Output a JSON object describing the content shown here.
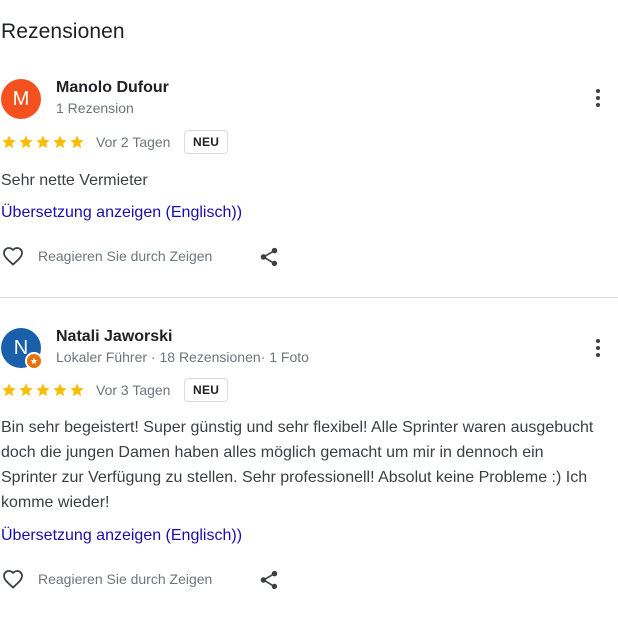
{
  "section": {
    "title": "Rezensionen"
  },
  "reviews": [
    {
      "avatar_letter": "M",
      "avatar_color": "#f4511e",
      "name": "Manolo Dufour",
      "meta": "1 Rezension",
      "rating": 5,
      "date": "Vor 2 Tagen",
      "badge": "NEU",
      "text": "Sehr nette Vermieter",
      "translate_label": "Übersetzung anzeigen (Englisch))",
      "react_label": "Reagieren Sie durch Zeigen"
    },
    {
      "avatar_letter": "N",
      "avatar_color": "#1a5faa",
      "local_guide": true,
      "name": "Natali Jaworski",
      "meta": "Lokaler Führer · 18  Rezensionen· 1 Foto",
      "rating": 5,
      "date": "Vor 3 Tagen",
      "badge": "NEU",
      "text": "Bin sehr begeistert! Super günstig und sehr flexibel! Alle Sprinter waren ausgebucht doch die jungen Damen haben alles möglich gemacht um mir in dennoch ein Sprinter zur Verfügung zu stellen. Sehr professionell! Absolut keine Probleme :) Ich komme wieder!",
      "translate_label": "Übersetzung anzeigen (Englisch))",
      "react_label": "Reagieren Sie durch Zeigen"
    }
  ],
  "colors": {
    "star": "#fbbc04",
    "link": "#1a0dab",
    "meta": "#70757a"
  },
  "icons": [
    "more-vert-icon",
    "star-icon",
    "heart-outline-icon",
    "share-icon",
    "local-guide-icon"
  ]
}
